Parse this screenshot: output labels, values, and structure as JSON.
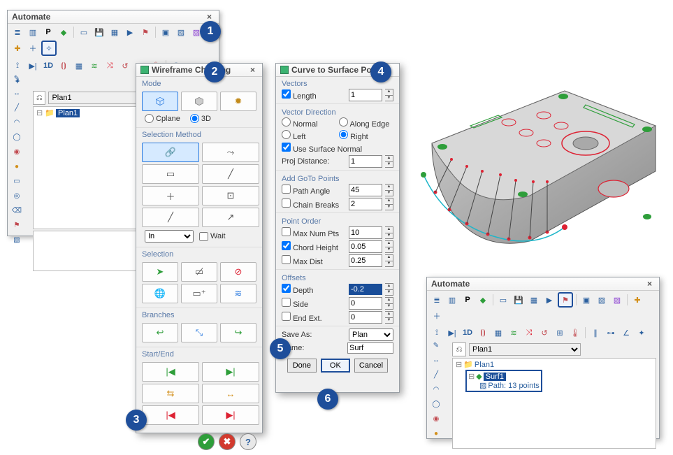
{
  "callouts": [
    "1",
    "2",
    "3",
    "4",
    "5",
    "6"
  ],
  "automateLeft": {
    "title": "Automate",
    "planCombo": "Plan1",
    "treeItem": "Plan1",
    "toolbar_row1": [
      "list-icon",
      "layers-icon",
      "bold-p-icon",
      "diamond-green-icon",
      "page-icon",
      "save-icon",
      "grid-icon",
      "play-icon",
      "flag-icon",
      "box-icon",
      "hatch-blue-icon",
      "hatch-multi-icon",
      "cross-icon",
      "plus-icon",
      "star-icon"
    ],
    "toolbar_row2": [
      "view-icon",
      "play-solid-icon",
      "one-d-icon",
      "bracket-icon",
      "grid-small-icon",
      "wave-icon",
      "axis-red-icon",
      "loop-icon",
      "net-icon",
      "thermo-icon",
      "bars-icon",
      "node-icon",
      "angle-icon",
      "sparkle-icon"
    ],
    "one_d_label": "1D",
    "side_tools": [
      "pencil-icon",
      "move-icon",
      "line-icon",
      "arc-icon",
      "oval-icon",
      "anchor-icon",
      "sphere-icon",
      "rect-icon",
      "target-icon",
      "eraser-icon",
      "flag2-icon",
      "swatch-icon"
    ]
  },
  "wireframe": {
    "title": "Wireframe Chaining",
    "mode": {
      "label": "Mode",
      "cplane": "Cplane",
      "threeD": "3D"
    },
    "selectionMethod": {
      "label": "Selection Method",
      "inLabelCombo": "In",
      "wait": "Wait"
    },
    "selection": {
      "label": "Selection"
    },
    "branches": {
      "label": "Branches"
    },
    "startEnd": {
      "label": "Start/End"
    }
  },
  "curve": {
    "title": "Curve to Surface Points",
    "vectors": {
      "label": "Vectors",
      "length": "Length",
      "lengthVal": "1"
    },
    "vectorDir": {
      "label": "Vector Direction",
      "normal": "Normal",
      "alongEdge": "Along Edge",
      "left": "Left",
      "right": "Right",
      "useSurf": "Use Surface Normal",
      "projDist": "Proj Distance:",
      "projDistVal": "1"
    },
    "addGoTo": {
      "label": "Add GoTo Points",
      "pathAngle": "Path Angle",
      "pathAngleVal": "45",
      "chainBreaks": "Chain Breaks",
      "chainBreaksVal": "2"
    },
    "pointOrder": {
      "label": "Point Order",
      "maxNumPts": "Max Num Pts",
      "maxNumPtsVal": "10",
      "chordHeight": "Chord Height",
      "chordHeightVal": "0.05",
      "maxDist": "Max Dist",
      "maxDistVal": "0.25"
    },
    "offsets": {
      "label": "Offsets",
      "depth": "Depth",
      "depthVal": "-0.2",
      "side": "Side",
      "sideVal": "0",
      "endExt": "End Ext.",
      "endExtVal": "0"
    },
    "save": {
      "saveAs": "Save As:",
      "saveAsVal": "Plan",
      "name": "Name:",
      "nameVal": "Surf"
    },
    "buttons": {
      "done": "Done",
      "ok": "OK",
      "cancel": "Cancel"
    }
  },
  "automateRight": {
    "title": "Automate",
    "planCombo": "Plan1",
    "tree": {
      "root": "Plan1",
      "surf": "Surf1",
      "path": "Path: 13 points"
    },
    "one_d_label": "1D"
  }
}
